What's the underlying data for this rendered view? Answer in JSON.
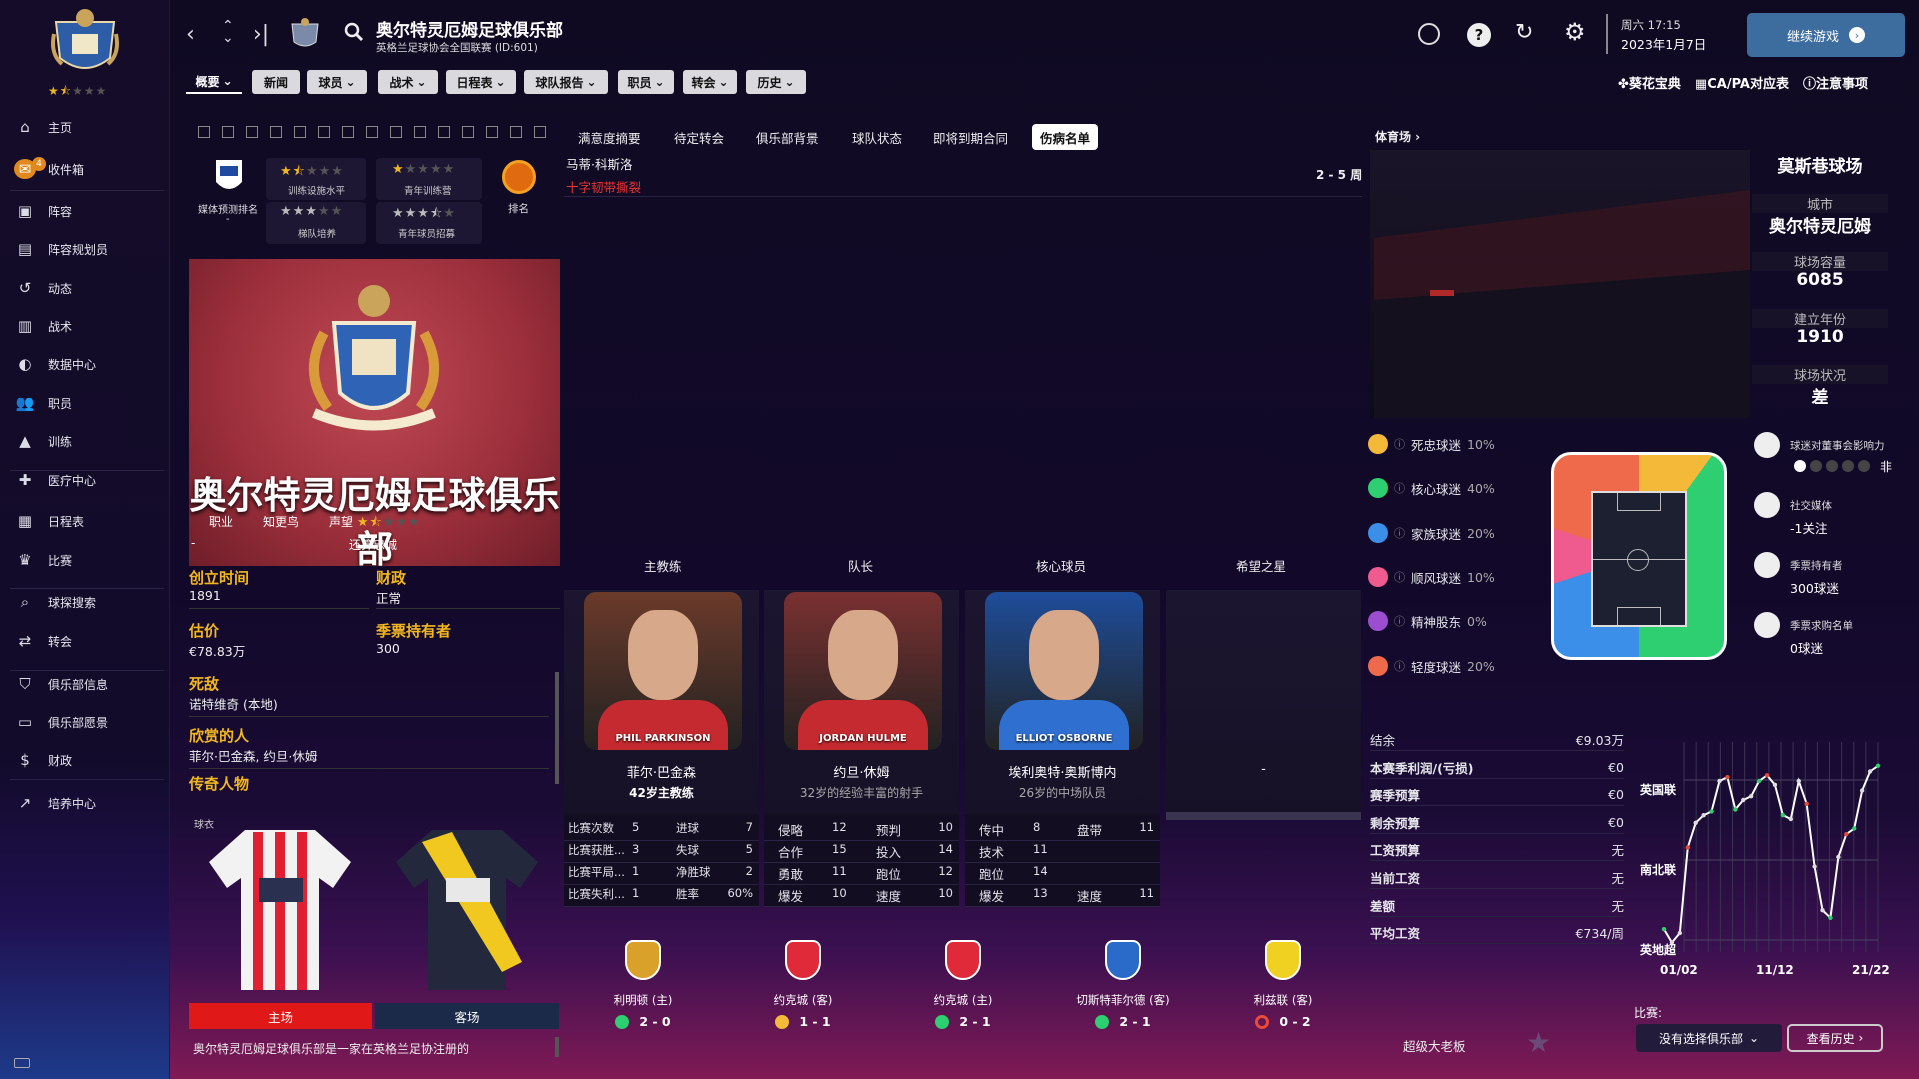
{
  "sidebar": {
    "items": [
      {
        "label": "主页",
        "icon": "home-icon"
      },
      {
        "label": "收件箱",
        "icon": "inbox-icon",
        "badge": "4"
      },
      {
        "label": "阵容",
        "icon": "shirt-icon"
      },
      {
        "label": "阵容规划员",
        "icon": "clipboard-icon"
      },
      {
        "label": "动态",
        "icon": "dynamics-icon"
      },
      {
        "label": "战术",
        "icon": "tactics-icon"
      },
      {
        "label": "数据中心",
        "icon": "data-hub-icon"
      },
      {
        "label": "职员",
        "icon": "staff-icon"
      },
      {
        "label": "训练",
        "icon": "training-icon"
      },
      {
        "label": "医疗中心",
        "icon": "medical-icon"
      },
      {
        "label": "日程表",
        "icon": "calendar-icon"
      },
      {
        "label": "比赛",
        "icon": "trophy-icon"
      },
      {
        "label": "球探搜索",
        "icon": "scouting-icon"
      },
      {
        "label": "转会",
        "icon": "transfer-icon"
      },
      {
        "label": "俱乐部信息",
        "icon": "shield-icon"
      },
      {
        "label": "俱乐部愿景",
        "icon": "vision-icon"
      },
      {
        "label": "财政",
        "icon": "finance-icon"
      },
      {
        "label": "培养中心",
        "icon": "development-icon"
      }
    ]
  },
  "header": {
    "club_name": "奥尔特灵厄姆足球俱乐部",
    "league": "英格兰足球协会全国联赛 (ID:601)",
    "date_line1": "周六 17:15",
    "date_line2": "2023年1月7日",
    "continue_label": "继续游戏",
    "links": [
      "葵花宝典",
      "CA/PA对应表",
      "注意事项"
    ]
  },
  "menu": [
    "概要",
    "新闻",
    "球员",
    "战术",
    "日程表",
    "球队报告",
    "职员",
    "转会",
    "历史"
  ],
  "subtabs": [
    "满意度摘要",
    "待定转会",
    "俱乐部背景",
    "球队状态",
    "即将到期合同",
    "伤病名单"
  ],
  "injury": {
    "player": "马蒂·科斯洛",
    "injury": "十字韧带撕裂",
    "duration": "2 - 5 周"
  },
  "club": {
    "media_label": "媒体预测排名",
    "media_value": "-",
    "training_label": "训练设施水平",
    "youth_label": "青年训练营",
    "academy_label": "梯队培养",
    "youth_recruit_label": "青年球员招募",
    "rank_label": "排名",
    "profile": [
      "职业",
      "知更鸟",
      "声望"
    ],
    "debt_label": "还算忠诚",
    "founded_label": "创立时间",
    "founded": "1891",
    "finance_label": "财政",
    "finance": "正常",
    "value_label": "估价",
    "value": "€78.83万",
    "season_label": "季票持有者",
    "season": "300",
    "rival_label": "死敌",
    "rival": "诺特维奇 (本地)",
    "admire_label": "欣赏的人",
    "admire": "菲尔·巴金森, 约旦·休姆",
    "legend_label": "传奇人物",
    "kit_label": "球衣",
    "home_label": "主场",
    "away_label": "客场",
    "desc": "奥尔特灵厄姆足球俱乐部是一家在英格兰足协注册的"
  },
  "people": {
    "headers": [
      "主教练",
      "队长",
      "核心球员",
      "希望之星"
    ],
    "cards": [
      {
        "name": "菲尔·巴金森",
        "sub": "42岁主教练",
        "tag": "PHIL PARKINSON",
        "stats": [
          [
            "比赛次数",
            "5",
            "进球",
            "7"
          ],
          [
            "比赛获胜...",
            "3",
            "失球",
            "5"
          ],
          [
            "比赛平局...",
            "1",
            "净胜球",
            "2"
          ],
          [
            "比赛失利...",
            "1",
            "胜率",
            "60%"
          ]
        ]
      },
      {
        "name": "约旦·休姆",
        "sub": "32岁的经验丰富的射手",
        "tag": "JORDAN HULME",
        "stats": [
          [
            "侵略",
            "12",
            "预判",
            "10"
          ],
          [
            "合作",
            "15",
            "投入",
            "14"
          ],
          [
            "勇敢",
            "11",
            "跑位",
            "12"
          ],
          [
            "爆发",
            "10",
            "速度",
            "10"
          ]
        ]
      },
      {
        "name": "埃利奥特·奥斯博内",
        "sub": "26岁的中场队员",
        "tag": "ELLIOT OSBORNE",
        "stats": [
          [
            "传中",
            "8",
            "盘带",
            "11"
          ],
          [
            "技术",
            "11",
            "",
            ""
          ],
          [
            "跑位",
            "14",
            "",
            ""
          ],
          [
            "爆发",
            "13",
            "速度",
            "11"
          ]
        ]
      },
      {
        "name": "-"
      }
    ]
  },
  "matches": [
    {
      "opp": "利明顿 (主)",
      "score": "2 - 0",
      "result": "win"
    },
    {
      "opp": "约克城 (客)",
      "score": "1 - 1",
      "result": "draw"
    },
    {
      "opp": "约克城 (主)",
      "score": "2 - 1",
      "result": "win"
    },
    {
      "opp": "切斯特菲尔德 (客)",
      "score": "2 - 1",
      "result": "win"
    },
    {
      "opp": "利兹联 (客)",
      "score": "0 - 2",
      "result": "loss"
    }
  ],
  "stadium": {
    "header": "体育场 ›",
    "name": "莫斯巷球场",
    "city_label": "城市",
    "city": "奥尔特灵厄姆",
    "cap_label": "球场容量",
    "cap": "6085",
    "built_label": "建立年份",
    "built": "1910",
    "cond_label": "球场状况",
    "cond": "差"
  },
  "fans": [
    {
      "label": "死忠球迷",
      "pct": "10%",
      "color": "#f5b93a"
    },
    {
      "label": "核心球迷",
      "pct": "40%",
      "color": "#2ecf70"
    },
    {
      "label": "家族球迷",
      "pct": "20%",
      "color": "#3b8fe8"
    },
    {
      "label": "顺风球迷",
      "pct": "10%",
      "color": "#ef5a8f"
    },
    {
      "label": "精神股东",
      "pct": "0%",
      "color": "#9b4fd0"
    },
    {
      "label": "轻度球迷",
      "pct": "20%",
      "color": "#ef6a4a"
    }
  ],
  "fan_info": [
    {
      "label": "球迷对董事会影响力",
      "value": "非"
    },
    {
      "label": "社交媒体",
      "value": "-1关注"
    },
    {
      "label": "季票持有者",
      "value": "300球迷"
    },
    {
      "label": "季票求购名单",
      "value": "0球迷"
    }
  ],
  "finances": [
    [
      "结余",
      "€9.03万"
    ],
    [
      "本赛季利润/(亏损)",
      "€0"
    ],
    [
      "赛季预算",
      "€0"
    ],
    [
      "剩余预算",
      "€0"
    ],
    [
      "工资预算",
      "无"
    ],
    [
      "当前工资",
      "无"
    ],
    [
      "差额",
      "无"
    ],
    [
      "平均工资",
      "€734/周"
    ]
  ],
  "chart_data": {
    "type": "line",
    "ylabels": [
      "英国联",
      "南北联",
      "英地超"
    ],
    "xlabels": [
      "01/02",
      "11/12",
      "21/22"
    ],
    "values": [
      0.12,
      0.05,
      0.1,
      0.55,
      0.68,
      0.72,
      0.74,
      0.9,
      0.92,
      0.75,
      0.8,
      0.82,
      0.9,
      0.93,
      0.88,
      0.72,
      0.7,
      0.9,
      0.78,
      0.45,
      0.22,
      0.18,
      0.5,
      0.62,
      0.65,
      0.85,
      0.95,
      0.98
    ]
  },
  "compare": {
    "label": "比赛:",
    "select": "没有选择俱乐部",
    "history": "查看历史"
  },
  "board": {
    "label": "超级大老板"
  }
}
